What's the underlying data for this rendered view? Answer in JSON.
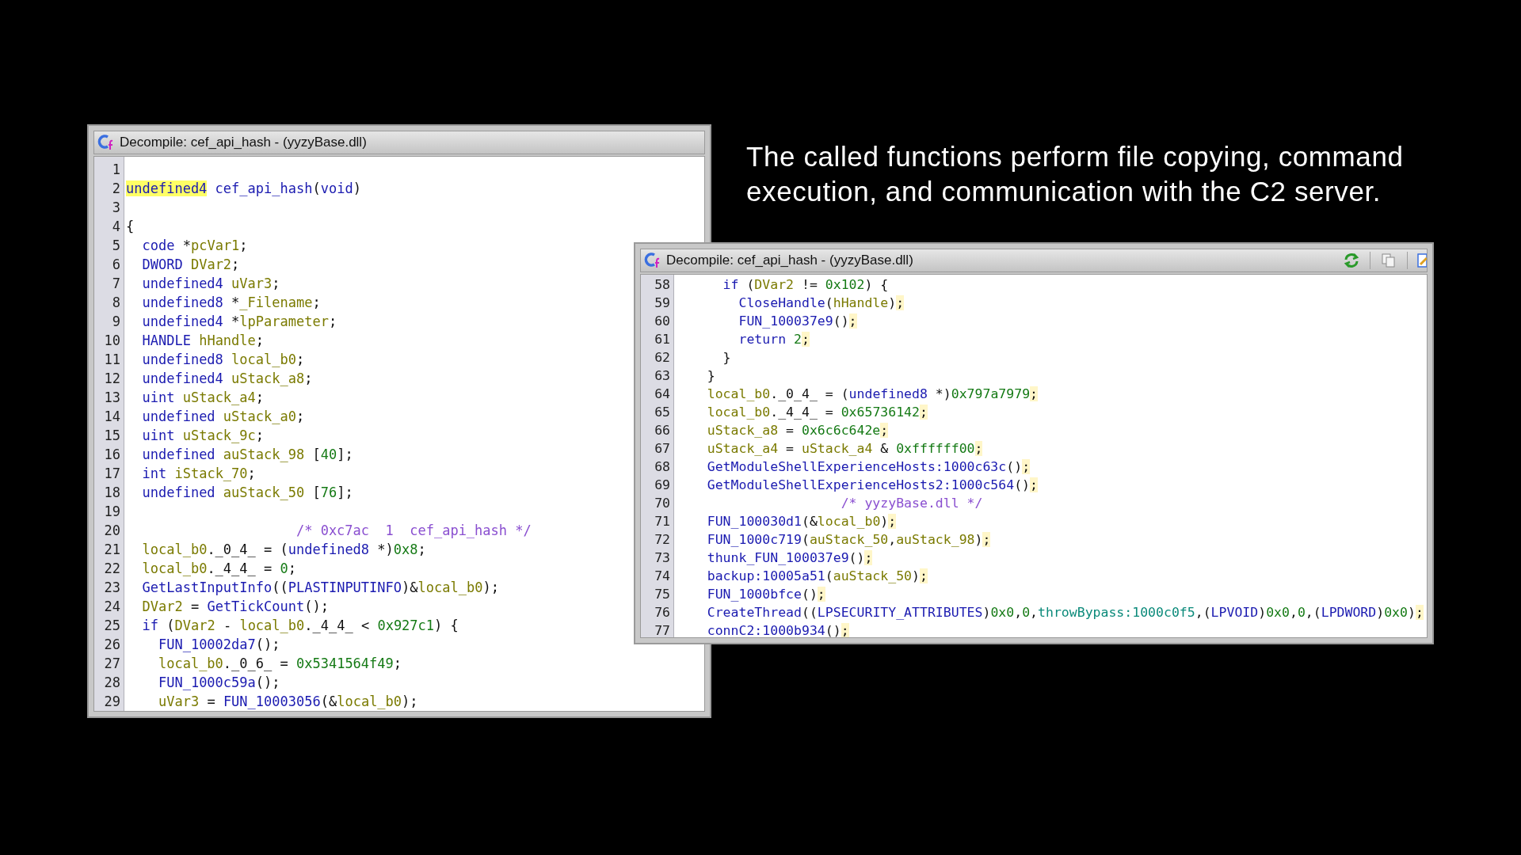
{
  "slide_caption": "The called functions perform file copying, command execution, and communication with the C2 server.",
  "windows": [
    {
      "title": "Decompile: cef_api_hash - (yyzyBase.dll)",
      "toolbar": false,
      "lines": [
        {
          "number": "1"
        },
        {
          "number": "2",
          "tokens": [
            {
              "kind": "hl",
              "text": "undefined4"
            },
            {
              "kind": "fn",
              "text": " cef_api_hash"
            },
            {
              "kind": "p",
              "text": "("
            },
            {
              "kind": "kw",
              "text": "void"
            },
            {
              "kind": "p",
              "text": ")"
            }
          ]
        },
        {
          "number": "3"
        },
        {
          "number": "4",
          "tokens": [
            {
              "kind": "p",
              "text": "{"
            }
          ]
        },
        {
          "number": "5",
          "tokens": [
            {
              "kind": "kw",
              "text": "  code"
            },
            {
              "kind": "p",
              "text": " *"
            },
            {
              "kind": "var",
              "text": "pcVar1"
            },
            {
              "kind": "p",
              "text": ";"
            }
          ]
        },
        {
          "number": "6",
          "tokens": [
            {
              "kind": "kw",
              "text": "  DWORD"
            },
            {
              "kind": "var",
              "text": " DVar2"
            },
            {
              "kind": "p",
              "text": ";"
            }
          ]
        },
        {
          "number": "7",
          "tokens": [
            {
              "kind": "kw",
              "text": "  undefined4"
            },
            {
              "kind": "var",
              "text": " uVar3"
            },
            {
              "kind": "p",
              "text": ";"
            }
          ]
        },
        {
          "number": "8",
          "tokens": [
            {
              "kind": "kw",
              "text": "  undefined8"
            },
            {
              "kind": "p",
              "text": " *"
            },
            {
              "kind": "var",
              "text": "_Filename"
            },
            {
              "kind": "p",
              "text": ";"
            }
          ]
        },
        {
          "number": "9",
          "tokens": [
            {
              "kind": "kw",
              "text": "  undefined4"
            },
            {
              "kind": "p",
              "text": " *"
            },
            {
              "kind": "var",
              "text": "lpParameter"
            },
            {
              "kind": "p",
              "text": ";"
            }
          ]
        },
        {
          "number": "10",
          "tokens": [
            {
              "kind": "kw",
              "text": "  HANDLE"
            },
            {
              "kind": "var",
              "text": " hHandle"
            },
            {
              "kind": "p",
              "text": ";"
            }
          ]
        },
        {
          "number": "11",
          "tokens": [
            {
              "kind": "kw",
              "text": "  undefined8"
            },
            {
              "kind": "var",
              "text": " local_b0"
            },
            {
              "kind": "p",
              "text": ";"
            }
          ]
        },
        {
          "number": "12",
          "tokens": [
            {
              "kind": "kw",
              "text": "  undefined4"
            },
            {
              "kind": "var",
              "text": " uStack_a8"
            },
            {
              "kind": "p",
              "text": ";"
            }
          ]
        },
        {
          "number": "13",
          "tokens": [
            {
              "kind": "kw",
              "text": "  uint"
            },
            {
              "kind": "var",
              "text": " uStack_a4"
            },
            {
              "kind": "p",
              "text": ";"
            }
          ]
        },
        {
          "number": "14",
          "tokens": [
            {
              "kind": "kw",
              "text": "  undefined"
            },
            {
              "kind": "var",
              "text": " uStack_a0"
            },
            {
              "kind": "p",
              "text": ";"
            }
          ]
        },
        {
          "number": "15",
          "tokens": [
            {
              "kind": "kw",
              "text": "  uint"
            },
            {
              "kind": "var",
              "text": " uStack_9c"
            },
            {
              "kind": "p",
              "text": ";"
            }
          ]
        },
        {
          "number": "16",
          "tokens": [
            {
              "kind": "kw",
              "text": "  undefined"
            },
            {
              "kind": "var",
              "text": " auStack_98"
            },
            {
              "kind": "p",
              "text": " ["
            },
            {
              "kind": "num",
              "text": "40"
            },
            {
              "kind": "p",
              "text": "];"
            }
          ]
        },
        {
          "number": "17",
          "tokens": [
            {
              "kind": "kw",
              "text": "  int"
            },
            {
              "kind": "var",
              "text": " iStack_70"
            },
            {
              "kind": "p",
              "text": ";"
            }
          ]
        },
        {
          "number": "18",
          "tokens": [
            {
              "kind": "kw",
              "text": "  undefined"
            },
            {
              "kind": "var",
              "text": " auStack_50"
            },
            {
              "kind": "p",
              "text": " ["
            },
            {
              "kind": "num",
              "text": "76"
            },
            {
              "kind": "p",
              "text": "];"
            }
          ]
        },
        {
          "number": "19"
        },
        {
          "number": "20",
          "tokens": [
            {
              "kind": "cmt",
              "text": "                     /* 0xc7ac  1  cef_api_hash */"
            }
          ]
        },
        {
          "number": "21",
          "tokens": [
            {
              "kind": "var",
              "text": "  local_b0"
            },
            {
              "kind": "p",
              "text": "._0_4_ = ("
            },
            {
              "kind": "kw",
              "text": "undefined8"
            },
            {
              "kind": "p",
              "text": " *)"
            },
            {
              "kind": "num",
              "text": "0x8"
            },
            {
              "kind": "p",
              "text": ";"
            }
          ]
        },
        {
          "number": "22",
          "tokens": [
            {
              "kind": "var",
              "text": "  local_b0"
            },
            {
              "kind": "p",
              "text": "._4_4_ = "
            },
            {
              "kind": "num",
              "text": "0"
            },
            {
              "kind": "p",
              "text": ";"
            }
          ]
        },
        {
          "number": "23",
          "tokens": [
            {
              "kind": "fn",
              "text": "  GetLastInputInfo"
            },
            {
              "kind": "p",
              "text": "(("
            },
            {
              "kind": "kw",
              "text": "PLASTINPUTINFO"
            },
            {
              "kind": "p",
              "text": ")&"
            },
            {
              "kind": "var",
              "text": "local_b0"
            },
            {
              "kind": "p",
              "text": ");"
            }
          ]
        },
        {
          "number": "24",
          "tokens": [
            {
              "kind": "var",
              "text": "  DVar2"
            },
            {
              "kind": "p",
              "text": " = "
            },
            {
              "kind": "fn",
              "text": "GetTickCount"
            },
            {
              "kind": "p",
              "text": "();"
            }
          ]
        },
        {
          "number": "25",
          "tokens": [
            {
              "kind": "kw",
              "text": "  if"
            },
            {
              "kind": "p",
              "text": " ("
            },
            {
              "kind": "var",
              "text": "DVar2"
            },
            {
              "kind": "p",
              "text": " - "
            },
            {
              "kind": "var",
              "text": "local_b0"
            },
            {
              "kind": "p",
              "text": "._4_4_ < "
            },
            {
              "kind": "num",
              "text": "0x927c1"
            },
            {
              "kind": "p",
              "text": ") {"
            }
          ]
        },
        {
          "number": "26",
          "tokens": [
            {
              "kind": "fn",
              "text": "    FUN_10002da7"
            },
            {
              "kind": "p",
              "text": "();"
            }
          ]
        },
        {
          "number": "27",
          "tokens": [
            {
              "kind": "var",
              "text": "    local_b0"
            },
            {
              "kind": "p",
              "text": "._0_6_ = "
            },
            {
              "kind": "num",
              "text": "0x5341564f49"
            },
            {
              "kind": "p",
              "text": ";"
            }
          ]
        },
        {
          "number": "28",
          "tokens": [
            {
              "kind": "fn",
              "text": "    FUN_1000c59a"
            },
            {
              "kind": "p",
              "text": "();"
            }
          ]
        },
        {
          "number": "29",
          "tokens": [
            {
              "kind": "var",
              "text": "    uVar3"
            },
            {
              "kind": "p",
              "text": " = "
            },
            {
              "kind": "fn",
              "text": "FUN_10003056"
            },
            {
              "kind": "p",
              "text": "(&"
            },
            {
              "kind": "var",
              "text": "local_b0"
            },
            {
              "kind": "p",
              "text": ");"
            }
          ]
        }
      ]
    },
    {
      "title": "Decompile: cef_api_hash - (yyzyBase.dll)",
      "toolbar": true,
      "lines": [
        {
          "number": "58",
          "tokens": [
            {
              "kind": "kw",
              "text": "      if"
            },
            {
              "kind": "p",
              "text": " ("
            },
            {
              "kind": "var",
              "text": "DVar2"
            },
            {
              "kind": "p",
              "text": " != "
            },
            {
              "kind": "num",
              "text": "0x102"
            },
            {
              "kind": "p",
              "text": ") {"
            }
          ]
        },
        {
          "number": "59",
          "tokens": [
            {
              "kind": "fn",
              "text": "        CloseHandle"
            },
            {
              "kind": "p",
              "text": "("
            },
            {
              "kind": "var",
              "text": "hHandle"
            },
            {
              "kind": "p",
              "text": ")"
            },
            {
              "kind": "semi",
              "text": ";"
            }
          ]
        },
        {
          "number": "60",
          "tokens": [
            {
              "kind": "fn",
              "text": "        FUN_100037e9"
            },
            {
              "kind": "p",
              "text": "()"
            },
            {
              "kind": "semi",
              "text": ";"
            }
          ]
        },
        {
          "number": "61",
          "tokens": [
            {
              "kind": "kw",
              "text": "        return"
            },
            {
              "kind": "num",
              "text": " 2"
            },
            {
              "kind": "semi",
              "text": ";"
            }
          ]
        },
        {
          "number": "62",
          "tokens": [
            {
              "kind": "p",
              "text": "      }"
            }
          ]
        },
        {
          "number": "63",
          "tokens": [
            {
              "kind": "p",
              "text": "    }"
            }
          ]
        },
        {
          "number": "64",
          "tokens": [
            {
              "kind": "var",
              "text": "    local_b0"
            },
            {
              "kind": "p",
              "text": "._0_4_ = ("
            },
            {
              "kind": "kw",
              "text": "undefined8"
            },
            {
              "kind": "p",
              "text": " *)"
            },
            {
              "kind": "num",
              "text": "0x797a7979"
            },
            {
              "kind": "semi",
              "text": ";"
            }
          ]
        },
        {
          "number": "65",
          "tokens": [
            {
              "kind": "var",
              "text": "    local_b0"
            },
            {
              "kind": "p",
              "text": "._4_4_ = "
            },
            {
              "kind": "num",
              "text": "0x65736142"
            },
            {
              "kind": "semi",
              "text": ";"
            }
          ]
        },
        {
          "number": "66",
          "tokens": [
            {
              "kind": "var",
              "text": "    uStack_a8"
            },
            {
              "kind": "p",
              "text": " = "
            },
            {
              "kind": "num",
              "text": "0x6c6c642e"
            },
            {
              "kind": "semi",
              "text": ";"
            }
          ]
        },
        {
          "number": "67",
          "tokens": [
            {
              "kind": "var",
              "text": "    uStack_a4"
            },
            {
              "kind": "p",
              "text": " = "
            },
            {
              "kind": "var",
              "text": "uStack_a4"
            },
            {
              "kind": "p",
              "text": " & "
            },
            {
              "kind": "num",
              "text": "0xffffff00"
            },
            {
              "kind": "semi",
              "text": ";"
            }
          ]
        },
        {
          "number": "68",
          "tokens": [
            {
              "kind": "fn",
              "text": "    GetModuleShellExperienceHosts:1000c63c"
            },
            {
              "kind": "p",
              "text": "()"
            },
            {
              "kind": "semi",
              "text": ";"
            }
          ]
        },
        {
          "number": "69",
          "tokens": [
            {
              "kind": "fn",
              "text": "    GetModuleShellExperienceHosts2:1000c564"
            },
            {
              "kind": "p",
              "text": "()"
            },
            {
              "kind": "semi",
              "text": ";"
            }
          ]
        },
        {
          "number": "70",
          "tokens": [
            {
              "kind": "cmt",
              "text": "                     /* yyzyBase.dll */"
            }
          ]
        },
        {
          "number": "71",
          "tokens": [
            {
              "kind": "fn",
              "text": "    FUN_100030d1"
            },
            {
              "kind": "p",
              "text": "(&"
            },
            {
              "kind": "var",
              "text": "local_b0"
            },
            {
              "kind": "p",
              "text": ")"
            },
            {
              "kind": "semi",
              "text": ";"
            }
          ]
        },
        {
          "number": "72",
          "tokens": [
            {
              "kind": "fn",
              "text": "    FUN_1000c719"
            },
            {
              "kind": "p",
              "text": "("
            },
            {
              "kind": "var",
              "text": "auStack_50"
            },
            {
              "kind": "p",
              "text": ","
            },
            {
              "kind": "var",
              "text": "auStack_98"
            },
            {
              "kind": "p",
              "text": ")"
            },
            {
              "kind": "semi",
              "text": ";"
            }
          ]
        },
        {
          "number": "73",
          "tokens": [
            {
              "kind": "fn",
              "text": "    thunk_FUN_100037e9"
            },
            {
              "kind": "p",
              "text": "()"
            },
            {
              "kind": "semi",
              "text": ";"
            }
          ]
        },
        {
          "number": "74",
          "tokens": [
            {
              "kind": "fn",
              "text": "    backup:10005a51"
            },
            {
              "kind": "p",
              "text": "("
            },
            {
              "kind": "var",
              "text": "auStack_50"
            },
            {
              "kind": "p",
              "text": ")"
            },
            {
              "kind": "semi",
              "text": ";"
            }
          ]
        },
        {
          "number": "75",
          "tokens": [
            {
              "kind": "fn",
              "text": "    FUN_1000bfce"
            },
            {
              "kind": "p",
              "text": "()"
            },
            {
              "kind": "semi",
              "text": ";"
            }
          ]
        },
        {
          "number": "76",
          "tokens": [
            {
              "kind": "fn",
              "text": "    CreateThread"
            },
            {
              "kind": "p",
              "text": "(("
            },
            {
              "kind": "kw",
              "text": "LPSECURITY_ATTRIBUTES"
            },
            {
              "kind": "p",
              "text": ")"
            },
            {
              "kind": "num",
              "text": "0x0"
            },
            {
              "kind": "p",
              "text": ","
            },
            {
              "kind": "num",
              "text": "0"
            },
            {
              "kind": "p",
              "text": ","
            },
            {
              "kind": "gv",
              "text": "throwBypass:1000c0f5"
            },
            {
              "kind": "p",
              "text": ",("
            },
            {
              "kind": "kw",
              "text": "LPVOID"
            },
            {
              "kind": "p",
              "text": ")"
            },
            {
              "kind": "num",
              "text": "0x0"
            },
            {
              "kind": "p",
              "text": ","
            },
            {
              "kind": "num",
              "text": "0"
            },
            {
              "kind": "p",
              "text": ",("
            },
            {
              "kind": "kw",
              "text": "LPDWORD"
            },
            {
              "kind": "p",
              "text": ")"
            },
            {
              "kind": "num",
              "text": "0x0"
            },
            {
              "kind": "p",
              "text": ")"
            },
            {
              "kind": "semi",
              "text": ";"
            }
          ]
        },
        {
          "number": "77",
          "tokens": [
            {
              "kind": "fn",
              "text": "    connC2:1000b934"
            },
            {
              "kind": "p",
              "text": "()"
            },
            {
              "kind": "semi",
              "text": ";"
            }
          ]
        }
      ]
    }
  ]
}
